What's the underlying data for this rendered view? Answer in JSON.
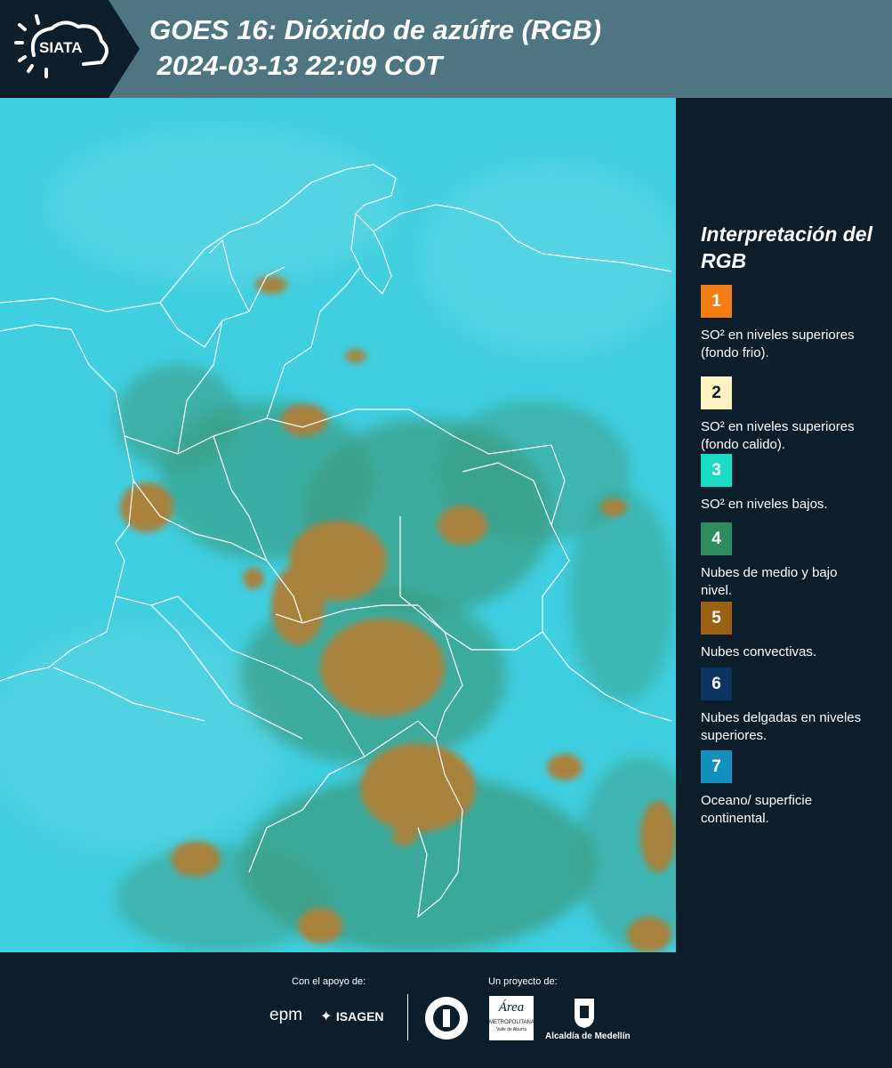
{
  "header": {
    "logo_text": "SIATA",
    "title_line1": "GOES 16: Dióxido de azúfre (RGB)",
    "title_line2": " 2024-03-13 22:09 COT"
  },
  "legend": {
    "title": "Interpretación del RGB",
    "items": [
      {
        "number": "1",
        "color": "#f27d12",
        "text": "SO² en niveles superiores (fondo frio)."
      },
      {
        "number": "2",
        "color": "#fbf4c2",
        "text": "SO² en niveles superiores (fondo calido)."
      },
      {
        "number": "3",
        "color": "#19dcc5",
        "text": "SO² en niveles bajos."
      },
      {
        "number": "4",
        "color": "#2e8c5e",
        "text": "Nubes de medio y bajo nivel."
      },
      {
        "number": "5",
        "color": "#9a6014",
        "text": "Nubes convectivas."
      },
      {
        "number": "6",
        "color": "#0d3460",
        "text": "Nubes delgadas en niveles superiores."
      },
      {
        "number": "7",
        "color": "#1391bd",
        "text": "Oceano/ superficie continental."
      }
    ]
  },
  "footer": {
    "support_label": "Con el apoyo de:",
    "project_label": "Un proyecto de:",
    "epm_text": "epm",
    "isagen_text": "ISAGEN",
    "area_text": "Área",
    "area_subtitle": "METROPOLITANA",
    "area_subtitle2": "Valle de Aburrá",
    "medellin_text": "Alcaldía de Medellín"
  },
  "colors": {
    "background": "#0c1e2c",
    "header_band": "#4f7583",
    "ocean": "#3fcfe1",
    "convective": "#a8813c",
    "low_cloud": "#2e8c5e"
  }
}
